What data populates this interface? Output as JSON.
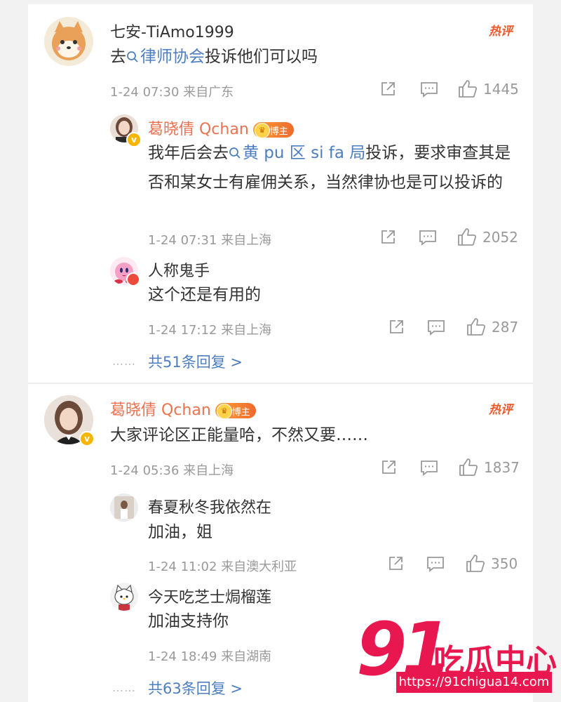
{
  "comments": [
    {
      "user": "七安-TiAmo1999",
      "hot_label": "热评",
      "text_parts": [
        "去",
        "律师协会",
        "投诉他们可以吗"
      ],
      "time": "1-24 07:30",
      "location": "来自广东",
      "likes": "1445",
      "replies": [
        {
          "user": "葛晓倩 Qchan",
          "badge": "博主",
          "text_parts": [
            "我年后会去",
            "黄 pu 区 si fa 局",
            "投诉，要求审查其是否和某女士有雇佣关系，当然律协也是可以投诉的"
          ],
          "time": "1-24 07:31",
          "location": "来自上海",
          "likes": "2052"
        },
        {
          "user": "人称鬼手",
          "text": "这个还是有用的",
          "time": "1-24 17:12",
          "location": "来自上海",
          "likes": "287"
        }
      ],
      "more_dots": "……",
      "more_replies": "共51条回复 >"
    },
    {
      "user": "葛晓倩 Qchan",
      "badge": "博主",
      "hot_label": "热评",
      "text": "大家评论区正能量哈，不然又要……",
      "time": "1-24 05:36",
      "location": "来自上海",
      "likes": "1837",
      "replies": [
        {
          "user": "春夏秋冬我依然在",
          "text": "加油，姐",
          "time": "1-24 11:02",
          "location": "来自澳大利亚",
          "likes": "350"
        },
        {
          "user": "今天吃芝士焗榴莲",
          "text": "加油支持你",
          "time": "1-24 18:49",
          "location": "来自湖南"
        }
      ],
      "more_dots": "……",
      "more_replies": "共63条回复 >"
    }
  ],
  "icons": {
    "search": "search-icon",
    "share": "share-icon",
    "comment": "comment-icon",
    "like": "thumb-up-icon",
    "verified": "verified-v-icon"
  },
  "watermark": {
    "number": "91",
    "text": "吃瓜中心",
    "url": "https://91chigua14.com"
  },
  "colors": {
    "link": "#4c7ec1",
    "username_highlight": "#eb7350",
    "hot": "#ea5a2c",
    "watermark": "#e9174f"
  }
}
